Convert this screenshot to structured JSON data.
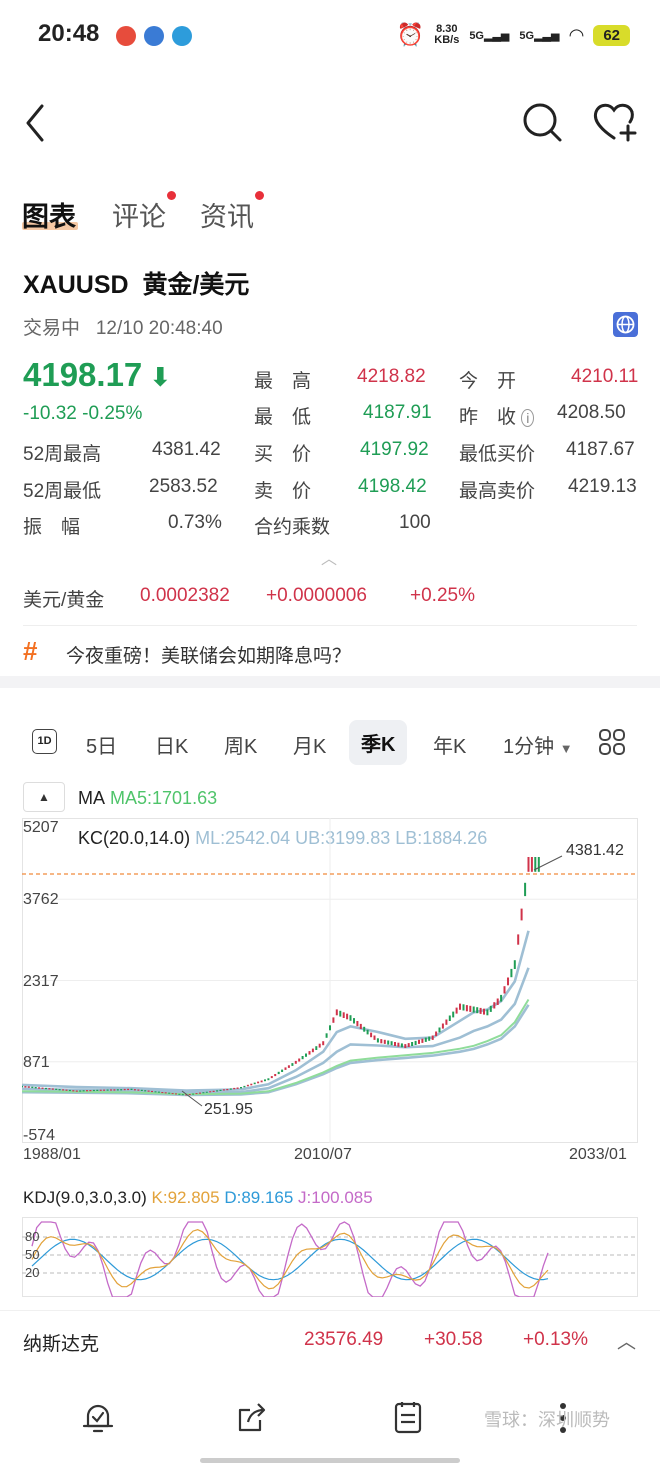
{
  "status_bar": {
    "time": "20:48",
    "net_speed_value": "8.30",
    "net_speed_unit": "KB/s",
    "sim1": "5G",
    "sim2": "5G",
    "battery": "62"
  },
  "tabs": [
    {
      "label": "图表",
      "active": true
    },
    {
      "label": "评论",
      "dot": true
    },
    {
      "label": "资讯",
      "dot": true
    }
  ],
  "instrument": {
    "symbol": "XAUUSD",
    "name": "黄金/美元",
    "status": "交易中",
    "datetime": "12/10 20:48:40",
    "last_price": "4198.17",
    "change": "-10.32",
    "change_pct": "-0.25%"
  },
  "quote_fields": {
    "high_label": "最　高",
    "high": "4218.82",
    "low_label": "最　低",
    "low": "4187.91",
    "open_label": "今　开",
    "open": "4210.11",
    "prev_close_label": "昨　收",
    "prev_close": "4208.50",
    "wk52_high_label": "52周最高",
    "wk52_high": "4381.42",
    "wk52_low_label": "52周最低",
    "wk52_low": "2583.52",
    "bid_label": "买　价",
    "bid": "4197.92",
    "ask_label": "卖　价",
    "ask": "4198.42",
    "min_bid_label": "最低买价",
    "min_bid": "4187.67",
    "max_ask_label": "最高卖价",
    "max_ask": "4219.13",
    "amplitude_label": "振　幅",
    "amplitude": "0.73%",
    "multiplier_label": "合约乘数",
    "multiplier": "100"
  },
  "cross_rate": {
    "label": "美元/黄金",
    "value": "0.0002382",
    "change": "+0.0000006",
    "change_pct": "+0.25%"
  },
  "topic": {
    "text": "今夜重磅！美联储会如期降息吗？"
  },
  "period_tabs": [
    "5日",
    "日K",
    "周K",
    "月K",
    "季K",
    "年K",
    "1分钟"
  ],
  "active_period": "季K",
  "indicators": {
    "ma_label": "MA",
    "ma5": "MA5:1701.63",
    "kc_label": "KC(20.0,14.0)",
    "kc_values": "ML:2542.04 UB:3199.83 LB:1884.26",
    "kdj_label": "KDJ(9.0,3.0,3.0)",
    "kdj_k": "K:92.805",
    "kdj_d": "D:89.165",
    "kdj_j": "J:100.085"
  },
  "chart_data": {
    "type": "line",
    "y_ticks": [
      "5207",
      "3762",
      "2317",
      "871",
      "-574"
    ],
    "x_ticks": [
      "1988/01",
      "2010/07",
      "2033/01"
    ],
    "annotations": {
      "max": "4381.42",
      "min": "251.95"
    },
    "kdj_ticks": [
      "80",
      "50",
      "20"
    ],
    "x": [
      "1988",
      "1992",
      "1996",
      "2000",
      "2004",
      "2006",
      "2008",
      "2010",
      "2011",
      "2012",
      "2014",
      "2016",
      "2018",
      "2020",
      "2021",
      "2022",
      "2023",
      "2024",
      "2025"
    ],
    "series": [
      {
        "name": "price",
        "values": [
          430,
          350,
          380,
          280,
          410,
          560,
          860,
          1200,
          1750,
          1650,
          1250,
          1150,
          1300,
          1850,
          1800,
          1750,
          2000,
          2600,
          4381
        ]
      },
      {
        "name": "KC-UB",
        "values": [
          460,
          420,
          400,
          360,
          380,
          470,
          720,
          1050,
          1400,
          1500,
          1400,
          1280,
          1300,
          1600,
          1750,
          1800,
          1950,
          2300,
          3200
        ]
      },
      {
        "name": "KC-ML",
        "values": [
          390,
          370,
          360,
          320,
          330,
          400,
          600,
          850,
          1050,
          1180,
          1160,
          1130,
          1150,
          1300,
          1420,
          1500,
          1620,
          1900,
          2542
        ]
      },
      {
        "name": "KC-LB",
        "values": [
          330,
          320,
          310,
          280,
          290,
          330,
          470,
          650,
          760,
          850,
          900,
          940,
          980,
          1050,
          1100,
          1180,
          1280,
          1500,
          1884
        ]
      }
    ],
    "ylim": [
      -574,
      5207
    ]
  },
  "ticker": {
    "name": "纳斯达克",
    "value": "23576.49",
    "change": "+30.58",
    "change_pct": "+0.13%"
  },
  "watermark": "雪球：深圳顺势",
  "colors": {
    "up": "#d0334a",
    "down": "#1f9d55",
    "accent": "#f37021",
    "kc": "#9fbfd4",
    "ma": "#8fdc9a"
  }
}
